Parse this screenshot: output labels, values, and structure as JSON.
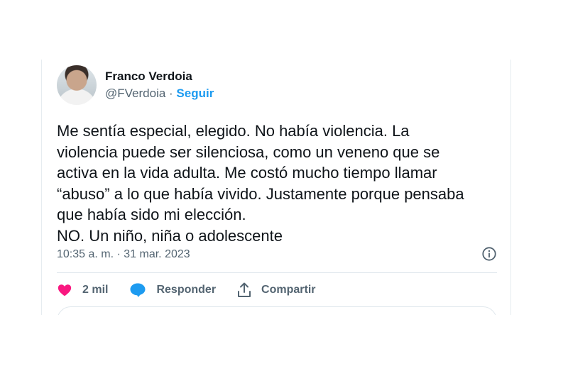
{
  "author": {
    "display_name": "Franco Verdoia",
    "handle": "@FVerdoia",
    "separator": " · ",
    "follow_label": "Seguir"
  },
  "tweet": {
    "text": "Me sentía especial, elegido. No había violencia. La\nviolencia puede ser silenciosa, como un veneno que se\nactiva en la vida adulta. Me costó mucho tiempo llamar\n“abuso” a lo que había vivido. Justamente porque pensaba\nque había sido mi elección.\nNO. Un niño, niña o adolescente",
    "timestamp": "10:35 a. m. · 31 mar. 2023"
  },
  "actions": {
    "likes_count": "2 mil",
    "reply_label": "Responder",
    "share_label": "Compartir"
  },
  "icons": {
    "like": "heart-icon",
    "reply": "speech-bubble-icon",
    "share": "share-arrow-icon",
    "info": "info-icon"
  },
  "colors": {
    "accent": "#1d9bf0",
    "like": "#f91880",
    "text": "#0f1419",
    "muted": "#536471"
  }
}
